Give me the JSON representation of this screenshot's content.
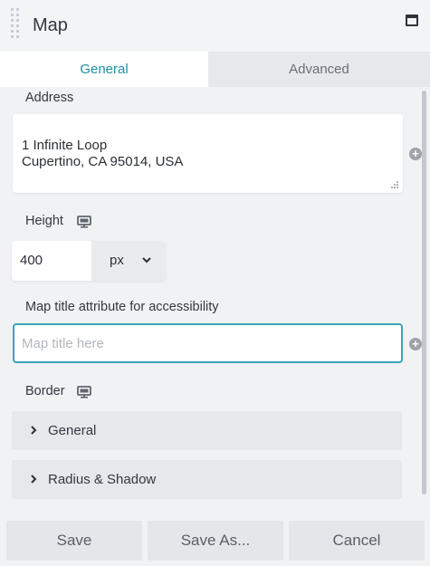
{
  "header": {
    "title": "Map",
    "drag_icon": "drag-handle-icon",
    "window_icon": "maximize-window-icon"
  },
  "tabs": [
    {
      "label": "General",
      "active": true
    },
    {
      "label": "Advanced",
      "active": false
    }
  ],
  "address": {
    "label": "Address",
    "value": "1 Infinite Loop\nCupertino, CA 95014, USA"
  },
  "height": {
    "label": "Height",
    "value": "400",
    "unit": "px",
    "icon": "desktop-monitor-icon"
  },
  "map_title": {
    "label": "Map title attribute for accessibility",
    "placeholder": "Map title here",
    "value": ""
  },
  "border": {
    "label": "Border",
    "icon": "desktop-monitor-icon",
    "sections": [
      {
        "label": "General"
      },
      {
        "label": "Radius & Shadow"
      }
    ]
  },
  "footer": {
    "save_label": "Save",
    "save_as_label": "Save As...",
    "cancel_label": "Cancel"
  },
  "colors": {
    "accent": "#1f8fa4",
    "focus_border": "#3aa5b5",
    "panel_bg": "#f1f2f4"
  }
}
